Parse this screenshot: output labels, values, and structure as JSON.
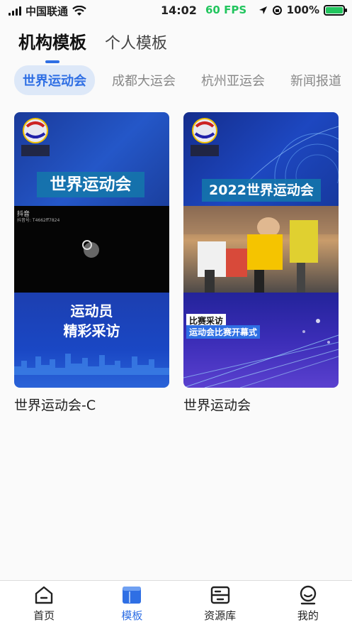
{
  "status_bar": {
    "carrier": "中国联通",
    "time": "14:02",
    "fps": "60 FPS",
    "battery": "100%",
    "battery_level": 1.0
  },
  "top_tabs": [
    {
      "label": "机构模板",
      "active": true
    },
    {
      "label": "个人模板",
      "active": false
    }
  ],
  "categories": [
    {
      "label": "世界运动会",
      "active": true
    },
    {
      "label": "成都大运会",
      "active": false
    },
    {
      "label": "杭州亚运会",
      "active": false
    },
    {
      "label": "新闻报道",
      "active": false
    }
  ],
  "templates": [
    {
      "title": "世界运动会-C",
      "thumb": {
        "banner": "世界运动会",
        "app_name": "抖音",
        "app_id": "抖音号: T4662ff7824",
        "line1": "运动员",
        "line2": "精彩采访"
      }
    },
    {
      "title": "世界运动会",
      "thumb": {
        "banner": "2022世界运动会",
        "tag1": "比赛采访",
        "tag2": "运动会比赛开幕式"
      }
    }
  ],
  "bottom_nav": [
    {
      "label": "首页",
      "icon": "home-icon",
      "active": false
    },
    {
      "label": "模板",
      "icon": "template-icon",
      "active": true
    },
    {
      "label": "资源库",
      "icon": "library-icon",
      "active": false
    },
    {
      "label": "我的",
      "icon": "profile-icon",
      "active": false
    }
  ],
  "colors": {
    "accent": "#2f6fe4",
    "fps": "#22c55e"
  }
}
